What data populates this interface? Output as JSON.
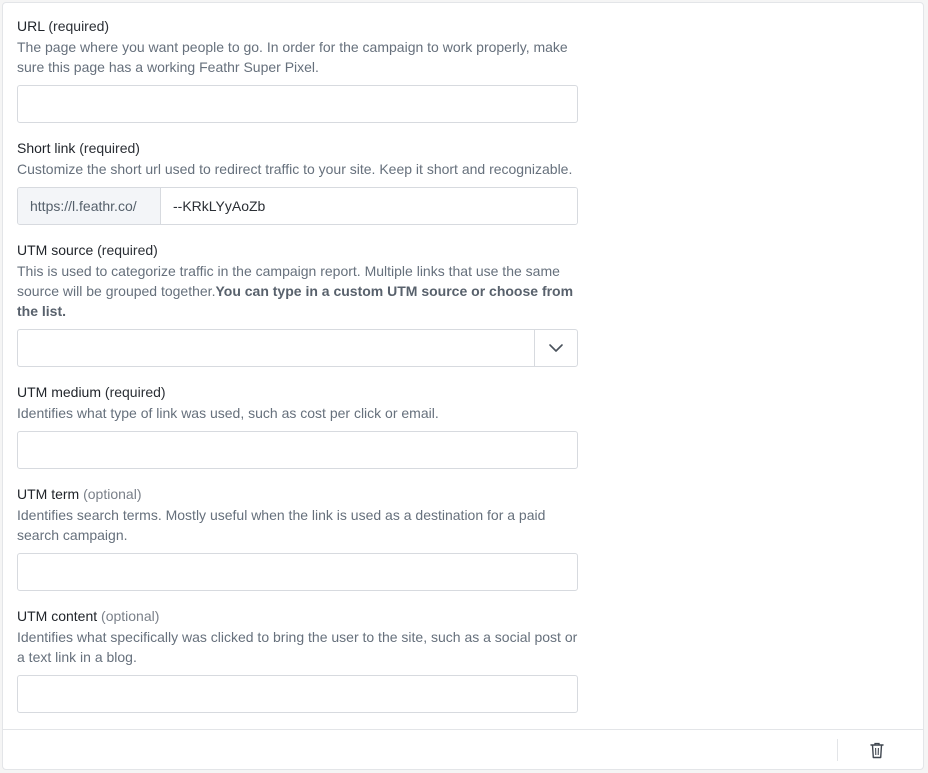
{
  "fields": {
    "url": {
      "label": "URL",
      "qualifier": "(required)",
      "description": "The page where you want people to go. In order for the campaign to work properly, make sure this page has a working Feathr Super Pixel.",
      "value": ""
    },
    "short_link": {
      "label": "Short link",
      "qualifier": "(required)",
      "description": "Customize the short url used to redirect traffic to your site. Keep it short and recognizable.",
      "prefix": "https://l.feathr.co/",
      "value": "--KRkLYyAoZb"
    },
    "utm_source": {
      "label": "UTM source",
      "qualifier": "(required)",
      "description": "This is used to categorize traffic in the campaign report. Multiple links that use the same source will be grouped together.",
      "description_bold": "You can type in a custom UTM source or choose from the list.",
      "value": ""
    },
    "utm_medium": {
      "label": "UTM medium",
      "qualifier": "(required)",
      "description": "Identifies what type of link was used, such as cost per click or email.",
      "value": ""
    },
    "utm_term": {
      "label": "UTM term",
      "qualifier": "(optional)",
      "description": "Identifies search terms. Mostly useful when the link is used as a destination for a paid search campaign.",
      "value": ""
    },
    "utm_content": {
      "label": "UTM content",
      "qualifier": "(optional)",
      "description": "Identifies what specifically was clicked to bring the user to the site, such as a social post or a text link in a blog.",
      "value": ""
    }
  },
  "icons": {
    "dropdown": "chevron-down-icon",
    "delete": "trash-icon"
  },
  "colors": {
    "border": "#d7dadf",
    "text": "#1f2329",
    "muted": "#66707c",
    "prefix_bg": "#f3f5f8"
  }
}
